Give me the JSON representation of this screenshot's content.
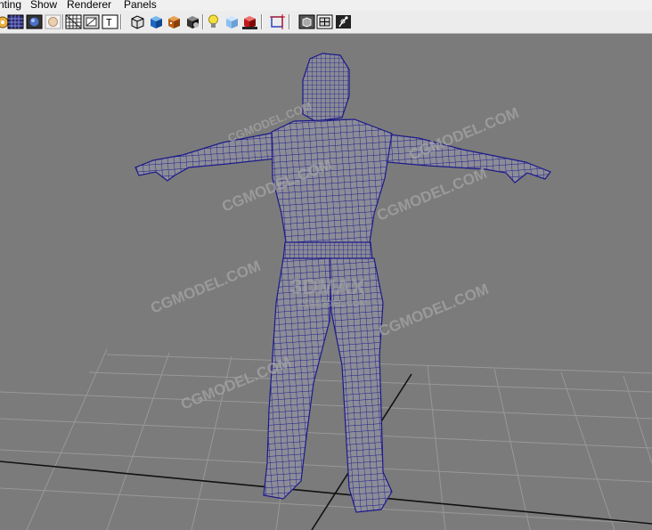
{
  "menu": {
    "items": [
      "nting",
      "Show",
      "Renderer",
      "Panels"
    ]
  },
  "toolbar": {
    "icons": [
      "camera-attributes-icon",
      "wireframe-icon",
      "smooth-shade-icon",
      "lighting-icon",
      "grid-toggle-icon",
      "image-plane-icon",
      "resolution-gate-icon",
      "safe-title-icon",
      "bounding-box-icon",
      "shaded-cube-icon",
      "textured-cube-icon",
      "isolate-select-icon",
      "use-default-light-icon",
      "ambient-light-icon",
      "shadows-icon",
      "frame-selection-icon",
      "xray-icon",
      "wireframe-on-shaded-icon",
      "joint-xray-icon"
    ]
  },
  "viewport": {
    "watermarks": [
      "CGMODEL.COM",
      "CGMODEL.COM",
      "CGMODEL.COM",
      "CGMODEL.COM",
      "CGMODEL.COM",
      "CGMODEL.COM",
      "CGMODEL.COM"
    ],
    "logo_text": "3DMAX",
    "logo_sub": "CGMODEL.COM"
  },
  "colors": {
    "background": "#7b7b7b",
    "grid": "#9a9a9a",
    "axis": "#111111",
    "mesh_fill": "#8c8c96",
    "wire": "#1c1a8a"
  }
}
